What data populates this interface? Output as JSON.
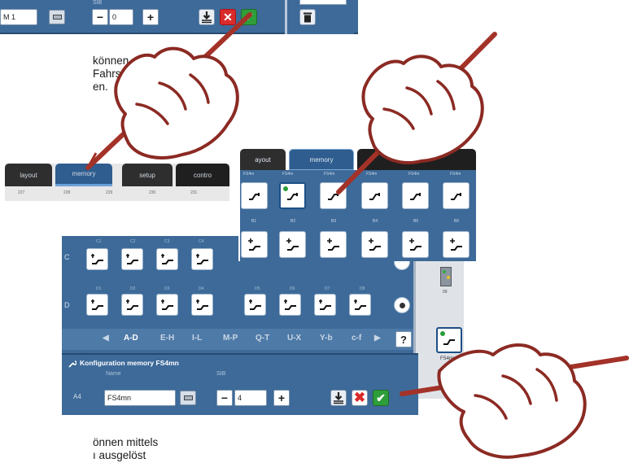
{
  "top_config": {
    "name_value": "M 1",
    "sib_label": "SIB",
    "step_value": "0",
    "minus": "−",
    "plus": "+"
  },
  "instruction_text": {
    "line1": "können",
    "line2": "Fahrstrassen",
    "line3": "en."
  },
  "tabbar": {
    "tabs": [
      {
        "label": "layout"
      },
      {
        "label": "memory"
      },
      {
        "label": "setup"
      },
      {
        "label": "contro"
      }
    ],
    "numbers": [
      "227",
      "228",
      "229",
      "230",
      "231"
    ]
  },
  "memory_panel": {
    "tabs": [
      {
        "label": "ayout"
      },
      {
        "label": "memory"
      }
    ],
    "top_labels": [
      "FS4m",
      "FS4m",
      "FS4m",
      "FS4m",
      "FS4m",
      "FS4m"
    ],
    "bottom_labels": [
      "B1",
      "B2",
      "B3",
      "B4",
      "B5",
      "B6"
    ]
  },
  "main_panel": {
    "row_c_label": "C",
    "row_d_label": "D",
    "col_labels_c": [
      "C1",
      "C2",
      "C3",
      "C4"
    ],
    "col_labels_d": [
      "D1",
      "D2",
      "D3",
      "D4",
      "D5",
      "D6",
      "D7",
      "D8"
    ],
    "nav_items": [
      "◀",
      "A-D",
      "E-H",
      "I-L",
      "M-P",
      "Q-T",
      "U-X",
      "Y-b",
      "c-f",
      "▶",
      "?"
    ],
    "right_col": {
      "loco_label": "09",
      "selected_label": "FS4mm"
    }
  },
  "config": {
    "title": "Konfiguration memory FS4mn",
    "name_label": "Name",
    "sib_label": "SIB",
    "address": "A4",
    "name_value": "FS4mn",
    "step_value": "4",
    "minus": "−",
    "plus": "+"
  },
  "bottom_text": {
    "line1": "önnen mittels",
    "line2": "ı ausgelöst"
  },
  "colors": {
    "panel_blue": "#3d6a99",
    "hand_outline": "#8b2a23",
    "pen": "#a33228",
    "confirm_green": "#2e9e3a",
    "cancel_red": "#d92b2b"
  }
}
